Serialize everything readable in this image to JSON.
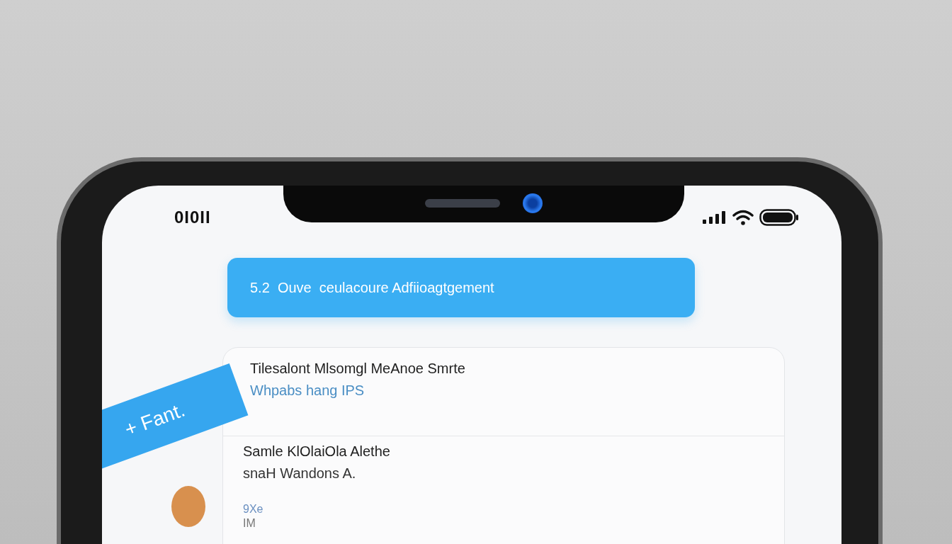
{
  "status_bar": {
    "time": "0I0II"
  },
  "banner": {
    "title": "5.2  Ouve  ceulacoure Adfiioagtgement"
  },
  "side_tab": {
    "label": "+ Fant."
  },
  "items": [
    {
      "kind": "link",
      "title": "Tilesalont Mlsomgl MeAnoe Smrte",
      "subtitle": "Whpabs hang IPS"
    },
    {
      "kind": "plain",
      "title": "Samle KlOlaiOla Alethe",
      "subtitle": "snaH Wandons A."
    },
    {
      "kind": "faint",
      "title": "9Xe",
      "subtitle": "IM"
    }
  ]
}
